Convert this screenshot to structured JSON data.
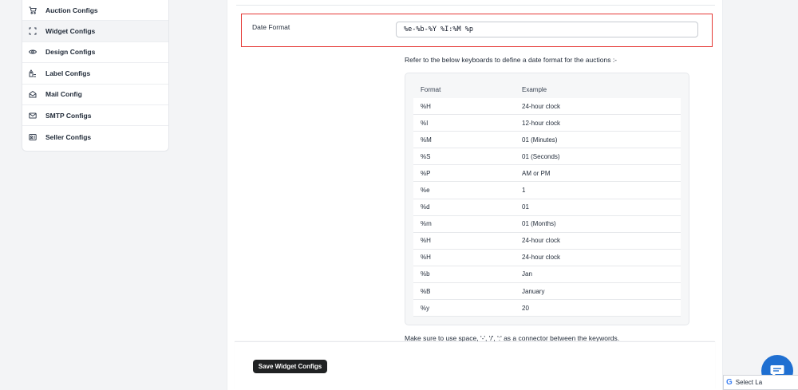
{
  "sidebar": {
    "items": [
      {
        "label": "Auction Configs",
        "icon": "cart-icon",
        "active": false
      },
      {
        "label": "Widget Configs",
        "icon": "frame-icon",
        "active": true
      },
      {
        "label": "Design Configs",
        "icon": "eye-icon",
        "active": false
      },
      {
        "label": "Label Configs",
        "icon": "label-icon",
        "active": false
      },
      {
        "label": "Mail Config",
        "icon": "mail-open-icon",
        "active": false
      },
      {
        "label": "SMTP Configs",
        "icon": "envelope-icon",
        "active": false
      },
      {
        "label": "Seller Configs",
        "icon": "id-card-icon",
        "active": false
      }
    ]
  },
  "date_format": {
    "label": "Date Format",
    "value": "%e-%b-%Y %I:%M %p"
  },
  "help_text": "Refer to the below keyboards to define a date format for the auctions :-",
  "format_table": {
    "headers": [
      "Format",
      "Example"
    ],
    "rows": [
      [
        "%H",
        "24-hour clock"
      ],
      [
        "%I",
        "12-hour clock"
      ],
      [
        "%M",
        "01 (Minutes)"
      ],
      [
        "%S",
        "01 (Seconds)"
      ],
      [
        "%P",
        "AM or PM"
      ],
      [
        "%e",
        "1"
      ],
      [
        "%d",
        "01"
      ],
      [
        "%m",
        "01 (Months)"
      ],
      [
        "%H",
        "24-hour clock"
      ],
      [
        "%H",
        "24-hour clock"
      ],
      [
        "%b",
        "Jan"
      ],
      [
        "%B",
        "January"
      ],
      [
        "%y",
        "20"
      ]
    ]
  },
  "note": "Make sure to use space, '-', '/', ':' as a connector between the keywords.",
  "footer": {
    "save_label": "Save Widget Configs"
  },
  "translate": {
    "label": "Select La"
  },
  "colors": {
    "highlight_border": "#e53935",
    "chat_button": "#1f6fd1",
    "save_button": "#202223"
  }
}
